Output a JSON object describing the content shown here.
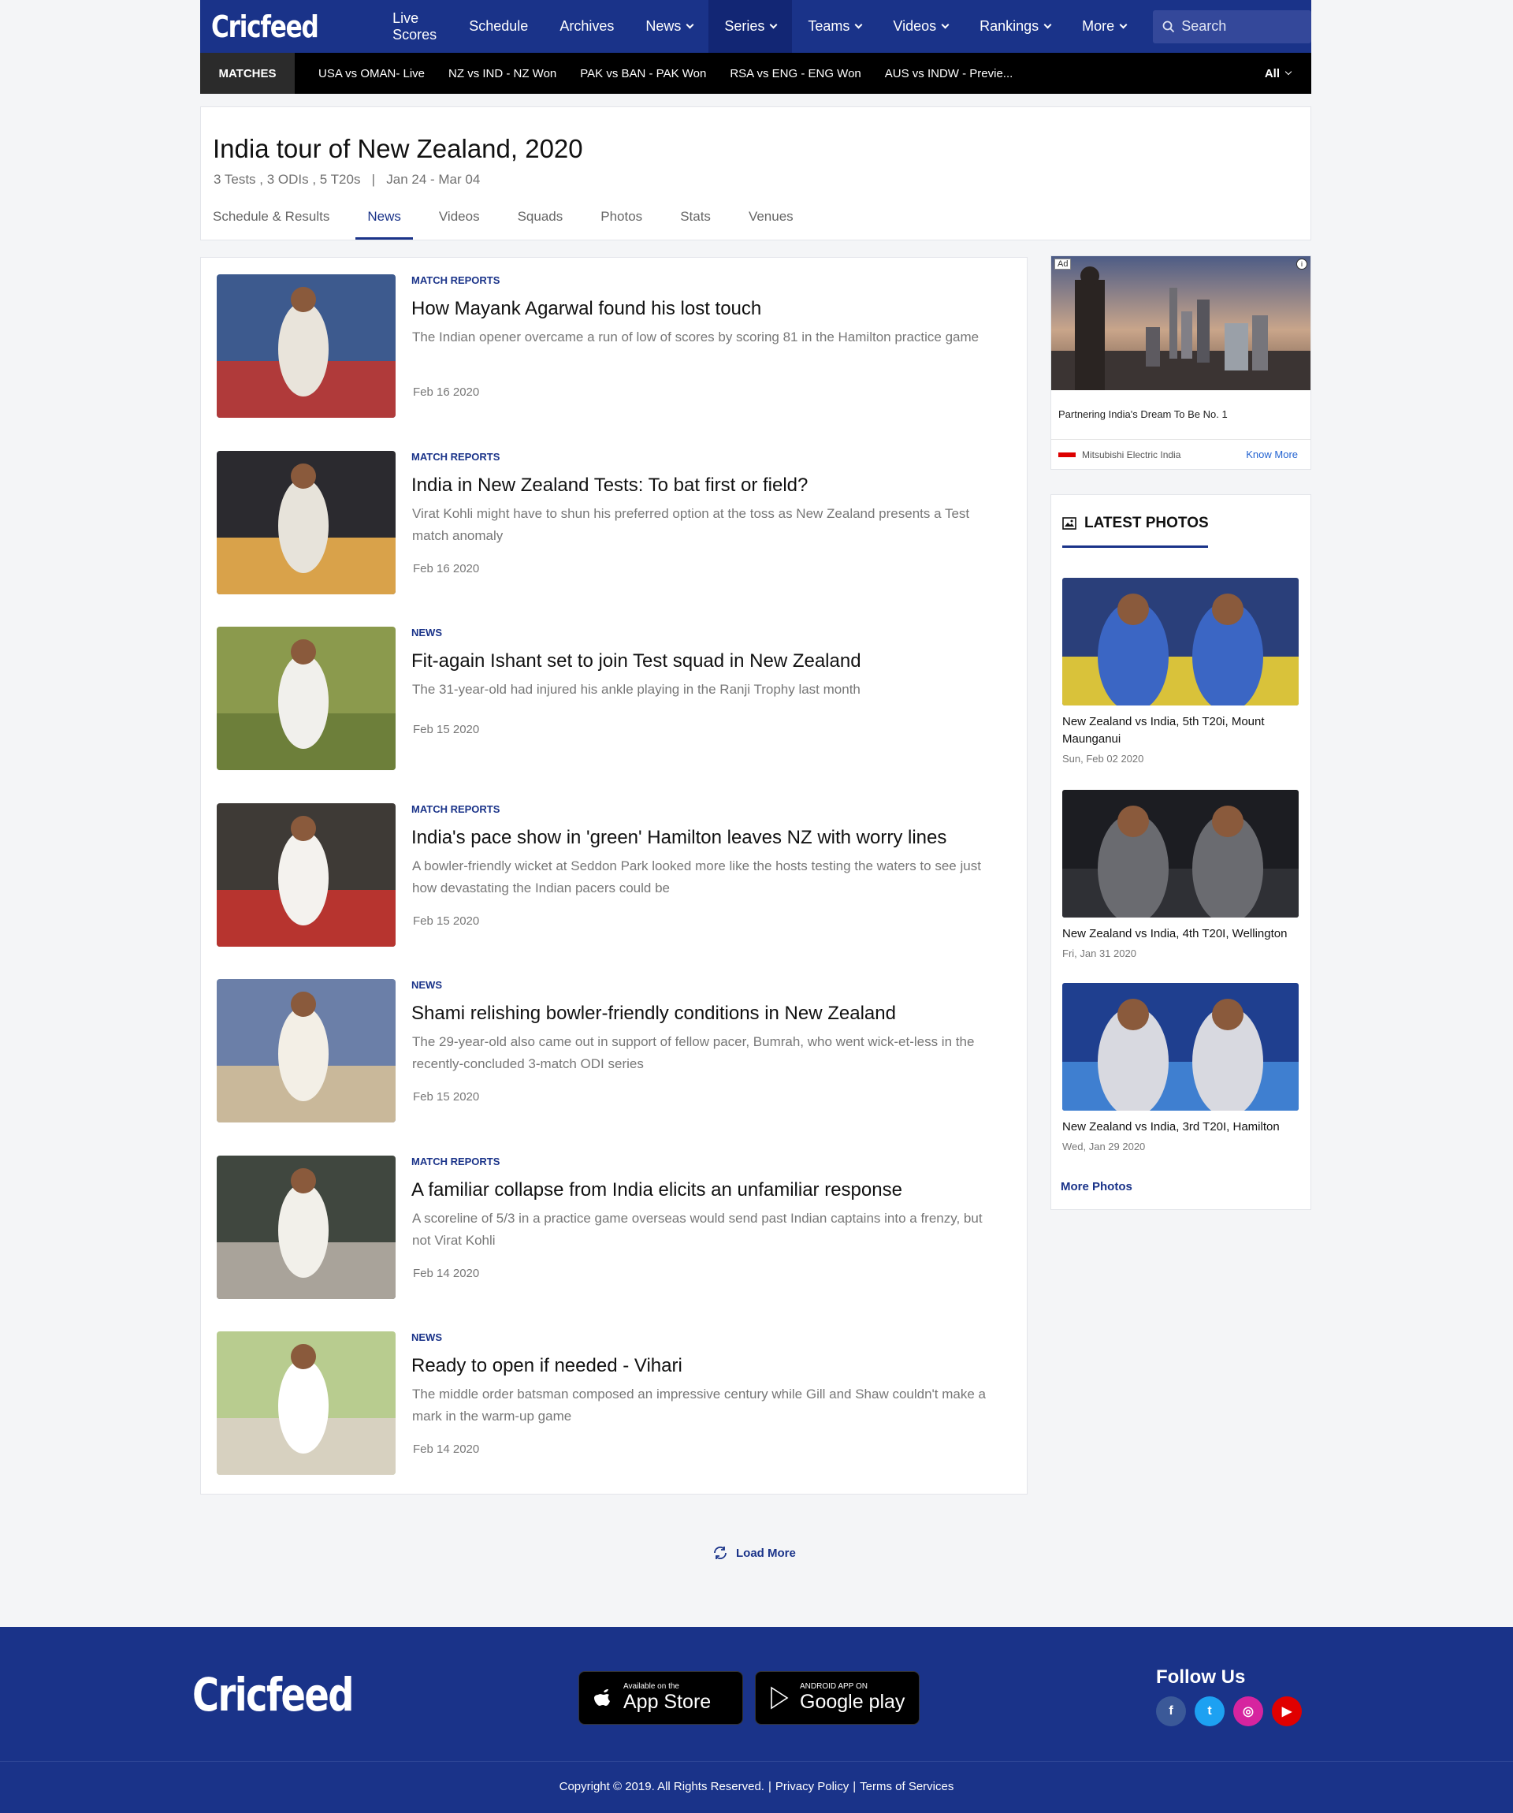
{
  "brand": "Cricfeed",
  "nav": {
    "items": [
      {
        "label": "Live Scores",
        "dropdown": false
      },
      {
        "label": "Schedule",
        "dropdown": false
      },
      {
        "label": "Archives",
        "dropdown": false
      },
      {
        "label": "News",
        "dropdown": true
      },
      {
        "label": "Series",
        "dropdown": true
      },
      {
        "label": "Teams",
        "dropdown": true
      },
      {
        "label": "Videos",
        "dropdown": true
      },
      {
        "label": "Rankings",
        "dropdown": true
      },
      {
        "label": "More",
        "dropdown": true
      }
    ],
    "search_placeholder": "Search"
  },
  "matches": {
    "label": "MATCHES",
    "items": [
      "USA vs OMAN- Live",
      "NZ vs IND - NZ Won",
      "PAK vs BAN - PAK Won",
      "RSA vs  ENG - ENG Won",
      "AUS vs INDW - Previe..."
    ],
    "filter": "All"
  },
  "series": {
    "title": "India tour of New Zealand, 2020",
    "formats": "3 Tests , 3 ODIs , 5 T20s",
    "dates": "Jan 24 - Mar 04",
    "tabs": [
      "Schedule & Results",
      "News",
      "Videos",
      "Squads",
      "Photos",
      "Stats",
      "Venues"
    ],
    "active_tab": "News"
  },
  "news": [
    {
      "category": "MATCH REPORTS",
      "title": "How Mayank Agarwal found his lost touch",
      "desc": "The Indian opener overcame a run of low of scores by scoring 81 in the Hamilton practice game",
      "date": "Feb 16 2020"
    },
    {
      "category": "MATCH REPORTS",
      "title": "India in New Zealand Tests: To bat first or field?",
      "desc": "Virat Kohli might have to shun his preferred option at the toss as New Zealand presents a Test match anomaly",
      "date": "Feb 16 2020"
    },
    {
      "category": "NEWS",
      "title": "Fit-again Ishant set to join Test squad in New Zealand",
      "desc": "The 31-year-old had injured his ankle playing in the Ranji Trophy last month",
      "date": "Feb 15 2020"
    },
    {
      "category": "MATCH REPORTS",
      "title": "India's pace show in 'green' Hamilton leaves NZ with worry lines",
      "desc": "A bowler-friendly wicket at Seddon Park looked more like the hosts testing the waters to see just how devastating the Indian pacers could be",
      "date": "Feb 15 2020"
    },
    {
      "category": "NEWS",
      "title": "Shami relishing bowler-friendly conditions in New Zealand",
      "desc": "The 29-year-old also came out in support of fellow pacer, Bumrah, who went wick-et-less in the recently-concluded 3-match ODI series",
      "date": "Feb 15 2020"
    },
    {
      "category": "MATCH REPORTS",
      "title": "A familiar collapse from India elicits an unfamiliar response",
      "desc": "A scoreline of 5/3 in a practice game overseas would send past Indian captains into a frenzy, but not Virat Kohli",
      "date": "Feb 14 2020"
    },
    {
      "category": "NEWS",
      "title": "Ready to open if needed - Vihari",
      "desc": "The middle order batsman composed an impressive century while Gill and Shaw couldn't make a mark in the warm-up game",
      "date": "Feb 14 2020"
    }
  ],
  "load_more": "Load More",
  "ad": {
    "badge": "Ad",
    "info": "i",
    "tagline": "Partnering India's Dream To Be No. 1",
    "advertiser": "Mitsubishi Electric India",
    "cta": "Know More"
  },
  "latest_photos": {
    "heading": "LATEST PHOTOS",
    "items": [
      {
        "caption": "New Zealand vs India, 5th T20i, Mount Maunganui",
        "date": "Sun, Feb 02 2020"
      },
      {
        "caption": "New Zealand vs India, 4th T20I, Wellington",
        "date": "Fri, Jan 31 2020"
      },
      {
        "caption": "New Zealand vs India, 3rd T20I, Hamilton",
        "date": "Wed, Jan 29 2020"
      }
    ],
    "more": "More Photos"
  },
  "footer": {
    "brand": "Cricfeed",
    "appstore_small": "Available on the",
    "appstore_big": "App Store",
    "googleplay_small": "ANDROID APP ON",
    "googleplay_big": "Google play",
    "follow": "Follow Us",
    "social": [
      {
        "name": "facebook",
        "glyph": "f",
        "color": "#3b5998"
      },
      {
        "name": "twitter",
        "glyph": "t",
        "color": "#1da1f2"
      },
      {
        "name": "instagram",
        "glyph": "◎",
        "color": "#d6249f"
      },
      {
        "name": "youtube",
        "glyph": "▶",
        "color": "#e00000"
      }
    ],
    "copyright": "Copyright © 2019. All Rights Reserved.",
    "privacy": "Privacy Policy",
    "terms": "Terms of Services"
  }
}
